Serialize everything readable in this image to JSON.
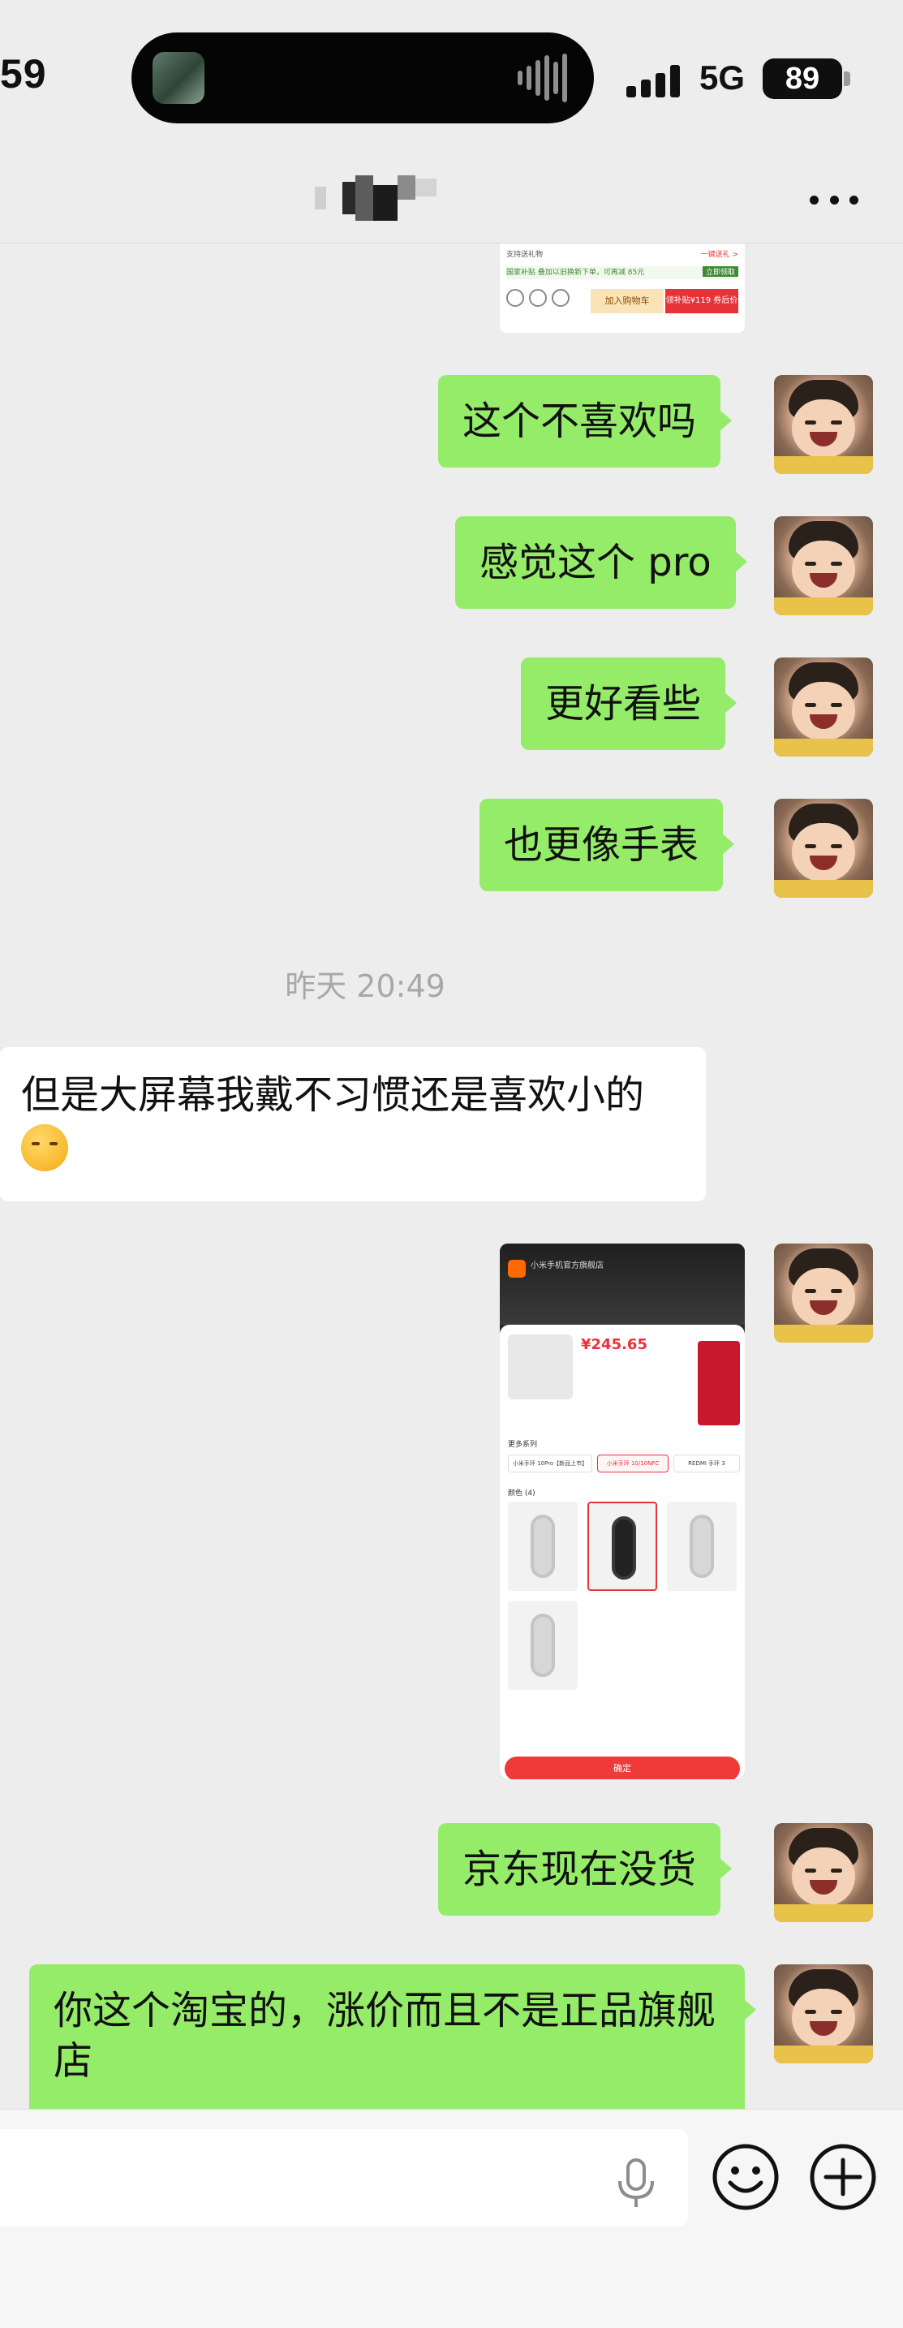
{
  "status": {
    "time": "59",
    "network": "5G",
    "battery": "89"
  },
  "nav": {
    "title": "",
    "more_label": "..."
  },
  "messages": [
    {
      "id": "m1",
      "direction": "out",
      "type": "image",
      "content": "screenshot"
    },
    {
      "id": "m2",
      "direction": "out",
      "type": "text",
      "text": "这个不喜欢吗"
    },
    {
      "id": "m3",
      "direction": "out",
      "type": "text",
      "text": "感觉这个 pro"
    },
    {
      "id": "m4",
      "direction": "out",
      "type": "text",
      "text": "更好看些"
    },
    {
      "id": "m5",
      "direction": "out",
      "type": "text",
      "text": "也更像手表"
    },
    {
      "id": "ts1",
      "type": "timestamp",
      "text": "昨天 20:49"
    },
    {
      "id": "m6",
      "direction": "in",
      "type": "text",
      "text": "但是大屏幕我戴不习惯还是喜欢小的",
      "emoji": "pensive-face-icon"
    },
    {
      "id": "m7",
      "direction": "out",
      "type": "image",
      "content": "screenshot"
    },
    {
      "id": "m8",
      "direction": "out",
      "type": "text",
      "text": "京东现在没货"
    },
    {
      "id": "m9",
      "direction": "out",
      "type": "text",
      "text": "你这个淘宝的，涨价而且不是正品旗舰店"
    }
  ],
  "screenshot_top": {
    "row1": "支持送礼物",
    "row1_right": "一键送礼 >",
    "row2": "国家补贴 叠加以旧换新下单，可再减 85元",
    "row2_right": "立即领取",
    "add_cart": "加入购物车",
    "buy_now": "领补贴¥119 券后价"
  },
  "screenshot_big": {
    "header_title": "小米手机官方旗舰店",
    "price": "¥245.65",
    "section_series": "更多系列",
    "chips": [
      "小米手环 10Pro【新品上市】",
      "小米手环 10/10NFC",
      "REDMI 手环 3"
    ],
    "section_color": "颜色 (4)",
    "confirm": "确定"
  },
  "input": {
    "placeholder": ""
  },
  "colors": {
    "background": "#ededed",
    "out_bubble": "#95ec69",
    "in_bubble": "#ffffff",
    "timestamp": "#a8a8a8"
  },
  "icons": {
    "mic": "mic-icon",
    "emoji": "smile-icon",
    "plus": "plus-icon",
    "more": "more-icon",
    "signal": "signal-icon"
  }
}
